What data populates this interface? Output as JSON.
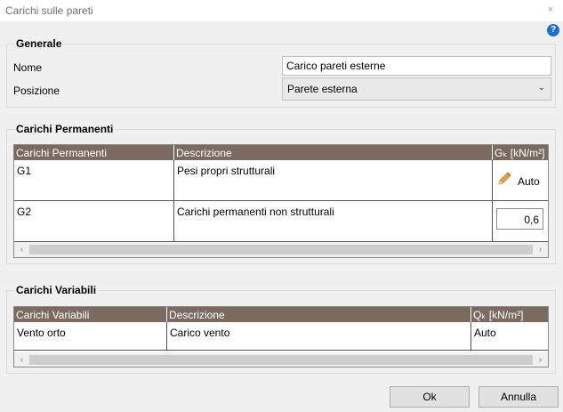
{
  "window": {
    "title": "Carichi sulle pareti",
    "close_glyph": "×"
  },
  "generale": {
    "title": "Generale",
    "nome_label": "Nome",
    "nome_value": "Carico pareti esterne",
    "posizione_label": "Posizione",
    "posizione_value": "Parete esterna"
  },
  "permanenti": {
    "title": "Carichi Permanenti",
    "columns": [
      "Carichi Permanenti",
      "Descrizione",
      "Gₖ [kN/m²]"
    ],
    "rows": [
      {
        "name": "G1",
        "description": "Pesi propri strutturali",
        "value": "Auto"
      },
      {
        "name": "G2",
        "description": "Carichi permanenti non strutturali",
        "value": "0,6"
      }
    ]
  },
  "variabili": {
    "title": "Carichi Variabili",
    "columns": [
      "Carichi Variabili",
      "Descrizione",
      "Qₖ [kN/m²]"
    ],
    "rows": [
      {
        "name": "Vento orto",
        "description": "Carico vento",
        "value": "Auto"
      }
    ]
  },
  "buttons": {
    "ok": "Ok",
    "annulla": "Annulla"
  },
  "icons": {
    "help": "?",
    "scroll_left": "‹",
    "scroll_right": "›",
    "chevron": "⌄"
  }
}
